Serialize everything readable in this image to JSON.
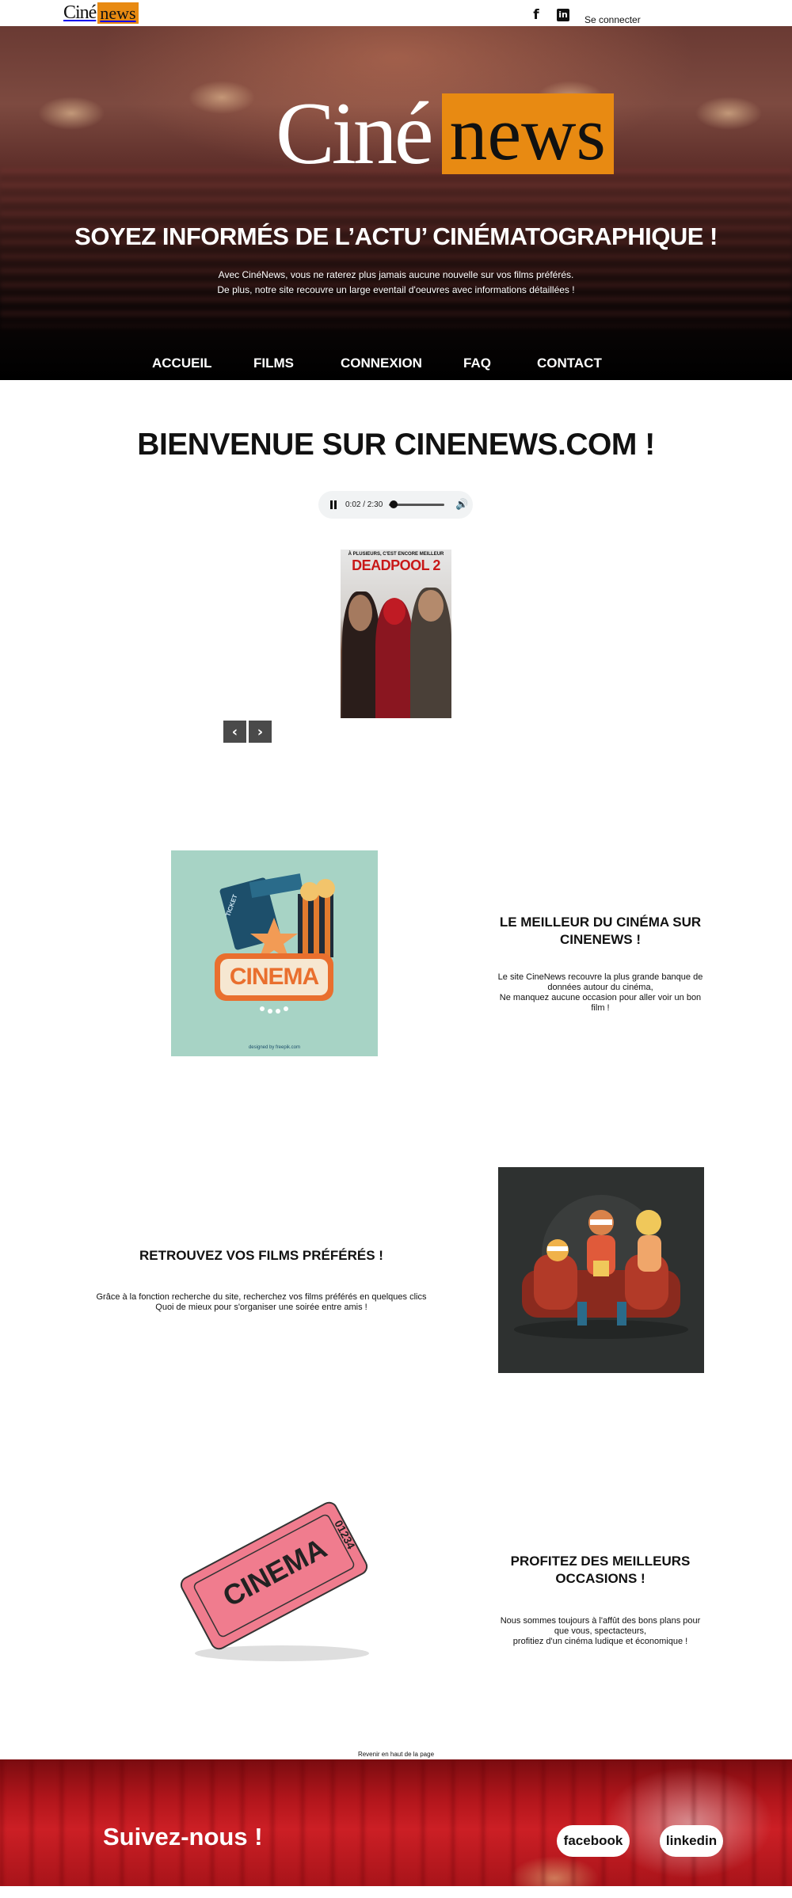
{
  "topbar": {
    "logo_cine": "Ciné",
    "logo_news": "news",
    "facebook_glyph": "f",
    "linkedin_glyph": "in",
    "login_label": "Se connecter"
  },
  "hero": {
    "logo_cine": "Ciné",
    "logo_news": "news",
    "title": "SOYEZ INFORMÉS DE L’ACTU’ CINÉMATOGRAPHIQUE !",
    "desc_line1": "Avec CinéNews, vous ne raterez plus jamais aucune nouvelle sur vos films préférés.",
    "desc_line2": "De plus, notre site recouvre un large eventail d'oeuvres avec informations détaillées !"
  },
  "nav": {
    "items": [
      "ACCUEIL",
      "FILMS",
      "CONNEXION",
      "FAQ",
      "CONTACT"
    ]
  },
  "welcome": {
    "title": "BIENVENUE SUR CINENEWS.COM !"
  },
  "audio_player": {
    "time": "0:02 / 2:30",
    "progress": 0.013,
    "volume_icon": "speaker-icon"
  },
  "carousel": {
    "poster_tagline": "À PLUSIEURS, C'EST ENCORE MEILLEUR",
    "poster_title": "DEADPOOL 2",
    "prev_glyph": "‹",
    "next_glyph": "›"
  },
  "section1": {
    "title": "LE MEILLEUR DU CINÉMA SUR CINENEWS !",
    "text_line1": "Le site CineNews recouvre la plus grande banque de",
    "text_line2": "données autour du cinéma,",
    "text_line3": "Ne manquez aucune occasion pour aller voir un bon",
    "text_line4": "film !",
    "image_sign": "CINEMA",
    "image_ticket": "TICKET",
    "image_credit": "designed by freepik.com"
  },
  "section2": {
    "title": "RETROUVEZ VOS FILMS PRÉFÉRÉS !",
    "text_line1": "Grâce à la fonction recherche du site, recherchez vos films préférés en quelques clics",
    "text_line2": "Quoi de mieux pour s'organiser une soirée entre amis !"
  },
  "section3": {
    "title": "PROFITEZ DES MEILLEURS OCCASIONS !",
    "text_line1": "Nous sommes toujours à l'affût des bons plans pour",
    "text_line2": "que vous, spectacteurs,",
    "text_line3": "profitiez d'un cinéma ludique et économique !",
    "ticket_word": "CINEMA",
    "ticket_number": "01234"
  },
  "back_to_top": "Revenir en haut de la page",
  "footer": {
    "follow": "Suivez-nous !",
    "facebook": "facebook",
    "linkedin": "linkedin"
  },
  "colors": {
    "accent_orange": "#e88a12",
    "footer_red": "#cc1f25",
    "section1_bg": "#a7d3c5",
    "section2_bg": "#2e3130",
    "ticket_pink": "#f07c8e"
  }
}
